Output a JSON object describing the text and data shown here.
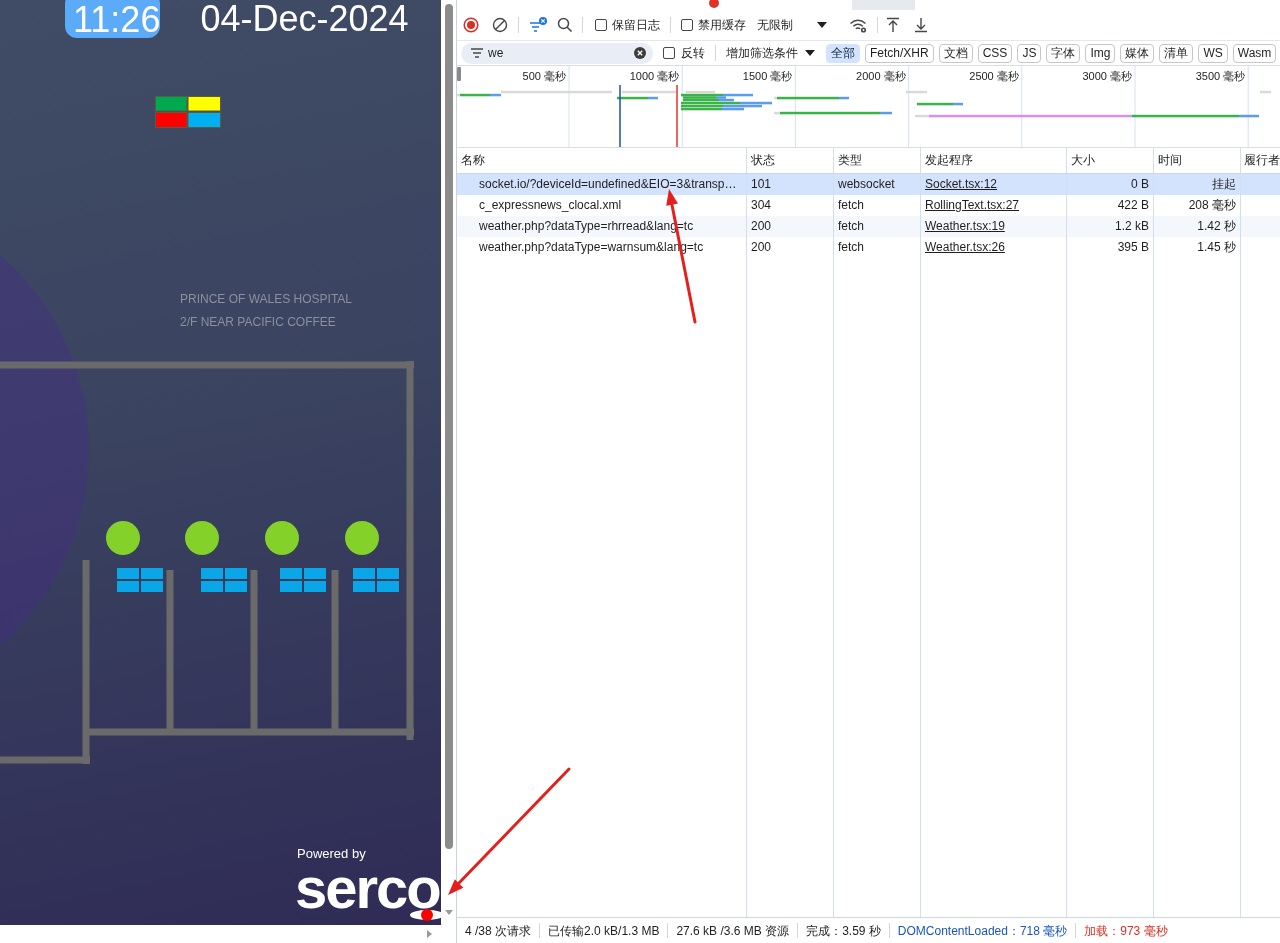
{
  "page_preview": {
    "clock": "11:26",
    "date": "04-Dec-2024",
    "location": [
      "PRINCE OF WALES HOSPITAL",
      "2/F NEAR PACIFIC COFFEE"
    ],
    "powered_by": "Powered by",
    "brand": "serco"
  },
  "devtools": {
    "toolbar": {
      "recording": true,
      "options": [
        {
          "label": "保留日志",
          "checked": false
        },
        {
          "label": "禁用缓存",
          "checked": false
        }
      ],
      "throttling": "无限制"
    },
    "filter": {
      "value": "we",
      "invert": {
        "label": "反转",
        "checked": false
      },
      "add_filter": "增加筛选条件",
      "types": [
        {
          "label": "全部",
          "selected": true
        },
        {
          "label": "Fetch/XHR",
          "selected": false
        },
        {
          "label": "文档",
          "selected": false
        },
        {
          "label": "CSS",
          "selected": false
        },
        {
          "label": "JS",
          "selected": false
        },
        {
          "label": "字体",
          "selected": false
        },
        {
          "label": "Img",
          "selected": false
        },
        {
          "label": "媒体",
          "selected": false
        },
        {
          "label": "清单",
          "selected": false
        },
        {
          "label": "WS",
          "selected": false
        },
        {
          "label": "Wasm",
          "selected": false
        }
      ]
    },
    "overview": {
      "ticks": [
        "500 毫秒",
        "1000 毫秒",
        "1500 毫秒",
        "2000 毫秒",
        "2500 毫秒",
        "3000 毫秒",
        "3500 毫秒"
      ]
    },
    "table": {
      "columns": [
        {
          "label": "名称",
          "kind": "name"
        },
        {
          "label": "状态",
          "kind": "text"
        },
        {
          "label": "类型",
          "kind": "text"
        },
        {
          "label": "发起程序",
          "kind": "link"
        },
        {
          "label": "大小",
          "kind": "number"
        },
        {
          "label": "时间",
          "kind": "number"
        },
        {
          "label": "履行者"
        }
      ],
      "rows": [
        {
          "selected": true,
          "cells": [
            "socket.io/?deviceId=undefined&EIO=3&transp…",
            "101",
            "websocket",
            "Socket.tsx:12",
            "0 B",
            "挂起"
          ]
        },
        {
          "selected": false,
          "cells": [
            "c_expressnews_clocal.xml",
            "304",
            "fetch",
            "RollingText.tsx:27",
            "422 B",
            "208 毫秒"
          ]
        },
        {
          "selected": false,
          "cells": [
            "weather.php?dataType=rhrread&lang=tc",
            "200",
            "fetch",
            "Weather.tsx:19",
            "1.2 kB",
            "1.42 秒"
          ]
        },
        {
          "selected": false,
          "cells": [
            "weather.php?dataType=warnsum&lang=tc",
            "200",
            "fetch",
            "Weather.tsx:26",
            "395 B",
            "1.45 秒"
          ]
        }
      ]
    },
    "status_bar": [
      {
        "text": "4 /38 次请求",
        "kind": "plain"
      },
      {
        "text": "已传输2.0 kB/1.3 MB",
        "kind": "plain"
      },
      {
        "text": "27.6 kB /3.6 MB 资源",
        "kind": "plain"
      },
      {
        "text": "完成：3.59 秒",
        "kind": "plain"
      },
      {
        "text": "DOMContentLoaded：718 毫秒",
        "kind": "dom"
      },
      {
        "text": "加载：973 毫秒",
        "kind": "load"
      }
    ]
  }
}
